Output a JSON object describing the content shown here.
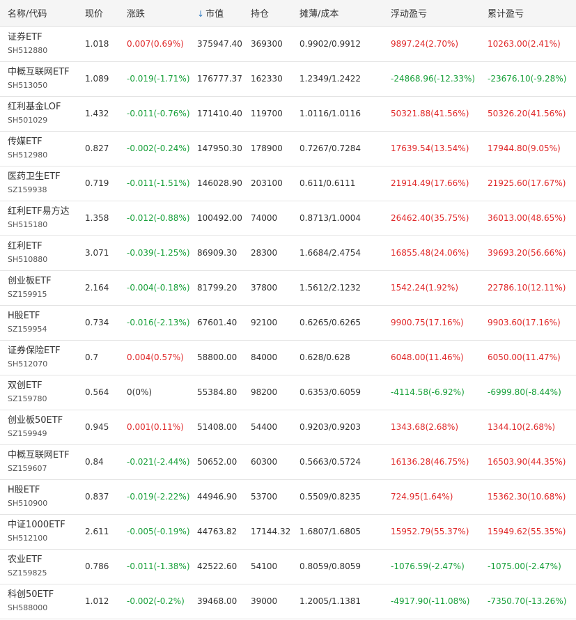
{
  "headers": {
    "name": "名称/代码",
    "price": "现价",
    "change": "涨跌",
    "sort_arrow": "↓",
    "market_value": "市值",
    "position": "持仓",
    "cost": "摊薄/成本",
    "float_pl": "浮动盈亏",
    "total_pl": "累计盈亏"
  },
  "colors": {
    "up": "#e0292a",
    "down": "#18a03a",
    "flat": "#333333",
    "accent": "#3b82c4"
  },
  "rows": [
    {
      "name": "证券ETF",
      "code": "SH512880",
      "price": "1.018",
      "change": "0.007(0.69%)",
      "change_dir": "up",
      "market_value": "375947.40",
      "position": "369300",
      "cost": "0.9902/0.9912",
      "float_pl": "9897.24(2.70%)",
      "float_dir": "up",
      "total_pl": "10263.00(2.41%)",
      "total_dir": "up"
    },
    {
      "name": "中概互联网ETF",
      "code": "SH513050",
      "price": "1.089",
      "change": "-0.019(-1.71%)",
      "change_dir": "down",
      "market_value": "176777.37",
      "position": "162330",
      "cost": "1.2349/1.2422",
      "float_pl": "-24868.96(-12.33%)",
      "float_dir": "down",
      "total_pl": "-23676.10(-9.28%)",
      "total_dir": "down"
    },
    {
      "name": "红利基金LOF",
      "code": "SH501029",
      "price": "1.432",
      "change": "-0.011(-0.76%)",
      "change_dir": "down",
      "market_value": "171410.40",
      "position": "119700",
      "cost": "1.0116/1.0116",
      "float_pl": "50321.88(41.56%)",
      "float_dir": "up",
      "total_pl": "50326.20(41.56%)",
      "total_dir": "up"
    },
    {
      "name": "传媒ETF",
      "code": "SH512980",
      "price": "0.827",
      "change": "-0.002(-0.24%)",
      "change_dir": "down",
      "market_value": "147950.30",
      "position": "178900",
      "cost": "0.7267/0.7284",
      "float_pl": "17639.54(13.54%)",
      "float_dir": "up",
      "total_pl": "17944.80(9.05%)",
      "total_dir": "up"
    },
    {
      "name": "医药卫生ETF",
      "code": "SZ159938",
      "price": "0.719",
      "change": "-0.011(-1.51%)",
      "change_dir": "down",
      "market_value": "146028.90",
      "position": "203100",
      "cost": "0.611/0.6111",
      "float_pl": "21914.49(17.66%)",
      "float_dir": "up",
      "total_pl": "21925.60(17.67%)",
      "total_dir": "up"
    },
    {
      "name": "红利ETF易方达",
      "code": "SH515180",
      "price": "1.358",
      "change": "-0.012(-0.88%)",
      "change_dir": "down",
      "market_value": "100492.00",
      "position": "74000",
      "cost": "0.8713/1.0004",
      "float_pl": "26462.40(35.75%)",
      "float_dir": "up",
      "total_pl": "36013.00(48.65%)",
      "total_dir": "up"
    },
    {
      "name": "红利ETF",
      "code": "SH510880",
      "price": "3.071",
      "change": "-0.039(-1.25%)",
      "change_dir": "down",
      "market_value": "86909.30",
      "position": "28300",
      "cost": "1.6684/2.4754",
      "float_pl": "16855.48(24.06%)",
      "float_dir": "up",
      "total_pl": "39693.20(56.66%)",
      "total_dir": "up"
    },
    {
      "name": "创业板ETF",
      "code": "SZ159915",
      "price": "2.164",
      "change": "-0.004(-0.18%)",
      "change_dir": "down",
      "market_value": "81799.20",
      "position": "37800",
      "cost": "1.5612/2.1232",
      "float_pl": "1542.24(1.92%)",
      "float_dir": "up",
      "total_pl": "22786.10(12.11%)",
      "total_dir": "up"
    },
    {
      "name": "H股ETF",
      "code": "SZ159954",
      "price": "0.734",
      "change": "-0.016(-2.13%)",
      "change_dir": "down",
      "market_value": "67601.40",
      "position": "92100",
      "cost": "0.6265/0.6265",
      "float_pl": "9900.75(17.16%)",
      "float_dir": "up",
      "total_pl": "9903.60(17.16%)",
      "total_dir": "up"
    },
    {
      "name": "证券保险ETF",
      "code": "SH512070",
      "price": "0.7",
      "change": "0.004(0.57%)",
      "change_dir": "up",
      "market_value": "58800.00",
      "position": "84000",
      "cost": "0.628/0.628",
      "float_pl": "6048.00(11.46%)",
      "float_dir": "up",
      "total_pl": "6050.00(11.47%)",
      "total_dir": "up"
    },
    {
      "name": "双创ETF",
      "code": "SZ159780",
      "price": "0.564",
      "change": "0(0%)",
      "change_dir": "flat",
      "market_value": "55384.80",
      "position": "98200",
      "cost": "0.6353/0.6059",
      "float_pl": "-4114.58(-6.92%)",
      "float_dir": "down",
      "total_pl": "-6999.80(-8.44%)",
      "total_dir": "down"
    },
    {
      "name": "创业板50ETF",
      "code": "SZ159949",
      "price": "0.945",
      "change": "0.001(0.11%)",
      "change_dir": "up",
      "market_value": "51408.00",
      "position": "54400",
      "cost": "0.9203/0.9203",
      "float_pl": "1343.68(2.68%)",
      "float_dir": "up",
      "total_pl": "1344.10(2.68%)",
      "total_dir": "up"
    },
    {
      "name": "中概互联网ETF",
      "code": "SZ159607",
      "price": "0.84",
      "change": "-0.021(-2.44%)",
      "change_dir": "down",
      "market_value": "50652.00",
      "position": "60300",
      "cost": "0.5663/0.5724",
      "float_pl": "16136.28(46.75%)",
      "float_dir": "up",
      "total_pl": "16503.90(44.35%)",
      "total_dir": "up"
    },
    {
      "name": "H股ETF",
      "code": "SH510900",
      "price": "0.837",
      "change": "-0.019(-2.22%)",
      "change_dir": "down",
      "market_value": "44946.90",
      "position": "53700",
      "cost": "0.5509/0.8235",
      "float_pl": "724.95(1.64%)",
      "float_dir": "up",
      "total_pl": "15362.30(10.68%)",
      "total_dir": "up"
    },
    {
      "name": "中证1000ETF",
      "code": "SH512100",
      "price": "2.611",
      "change": "-0.005(-0.19%)",
      "change_dir": "down",
      "market_value": "44763.82",
      "position": "17144.32",
      "cost": "1.6807/1.6805",
      "float_pl": "15952.79(55.37%)",
      "float_dir": "up",
      "total_pl": "15949.62(55.35%)",
      "total_dir": "up"
    },
    {
      "name": "农业ETF",
      "code": "SZ159825",
      "price": "0.786",
      "change": "-0.011(-1.38%)",
      "change_dir": "down",
      "market_value": "42522.60",
      "position": "54100",
      "cost": "0.8059/0.8059",
      "float_pl": "-1076.59(-2.47%)",
      "float_dir": "down",
      "total_pl": "-1075.00(-2.47%)",
      "total_dir": "down"
    },
    {
      "name": "科创50ETF",
      "code": "SH588000",
      "price": "1.012",
      "change": "-0.002(-0.2%)",
      "change_dir": "down",
      "market_value": "39468.00",
      "position": "39000",
      "cost": "1.2005/1.1381",
      "float_pl": "-4917.90(-11.08%)",
      "float_dir": "down",
      "total_pl": "-7350.70(-13.26%)",
      "total_dir": "down"
    }
  ]
}
